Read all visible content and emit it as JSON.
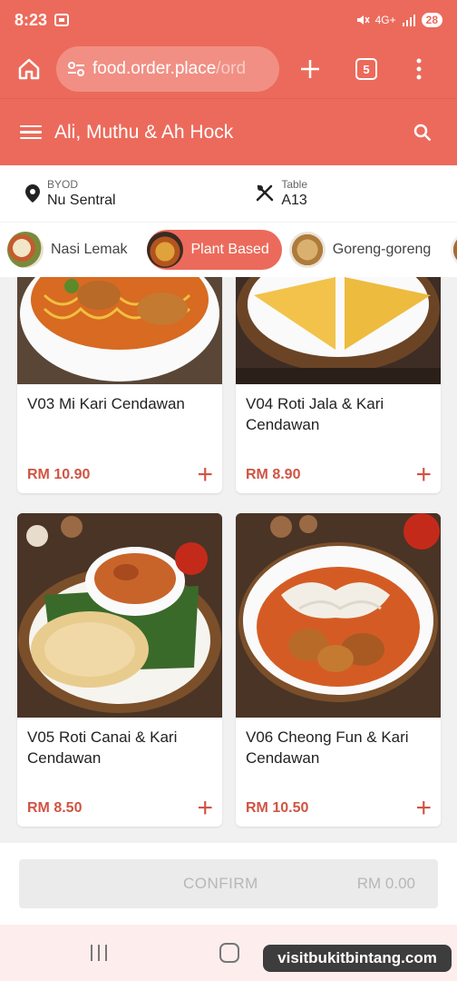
{
  "status_bar": {
    "time": "8:23",
    "network": "4G+",
    "battery": "28"
  },
  "browser": {
    "url_host": "food.order.place",
    "url_path": "/ord",
    "tab_count": "5"
  },
  "header": {
    "title": "Ali, Muthu & Ah Hock"
  },
  "info": {
    "byod_label": "BYOD",
    "byod_value": "Nu Sentral",
    "table_label": "Table",
    "table_value": "A13"
  },
  "categories": [
    {
      "label": "Nasi Lemak",
      "active": false
    },
    {
      "label": "Plant Based",
      "active": true
    },
    {
      "label": "Goreng-goreng",
      "active": false
    }
  ],
  "menu": {
    "items": [
      {
        "name": "V03 Mi Kari Cendawan",
        "price": "RM 10.90"
      },
      {
        "name": "V04 Roti Jala & Kari Cendawan",
        "price": "RM 8.90"
      },
      {
        "name": "V05 Roti Canai & Kari Cendawan",
        "price": "RM 8.50"
      },
      {
        "name": "V06 Cheong Fun & Kari Cendawan",
        "price": "RM 10.50"
      }
    ],
    "add_symbol": "+"
  },
  "confirm": {
    "label": "CONFIRM",
    "total": "RM 0.00"
  },
  "watermark": "visitbukitbintang.com",
  "colors": {
    "brand": "#ec6a5b",
    "price": "#d05443"
  }
}
